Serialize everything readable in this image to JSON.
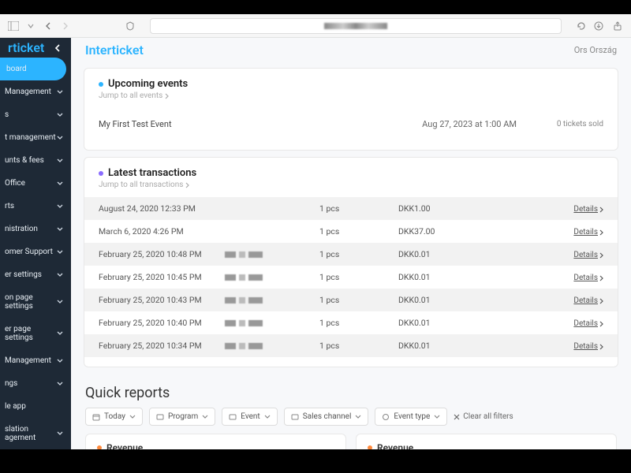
{
  "brand": "rticket",
  "main_title": "Interticket",
  "user": "Ors Ország",
  "sidebar": {
    "items": [
      {
        "label": "board",
        "active": true,
        "expandable": false
      },
      {
        "label": "Management",
        "expandable": true
      },
      {
        "label": "s",
        "expandable": true
      },
      {
        "label": "t management",
        "expandable": true
      },
      {
        "label": "unts & fees",
        "expandable": true
      },
      {
        "label": "Office",
        "expandable": true
      },
      {
        "label": "rts",
        "expandable": true
      },
      {
        "label": "nistration",
        "expandable": true
      },
      {
        "label": "omer Support",
        "expandable": true
      },
      {
        "label": "er settings",
        "expandable": true
      },
      {
        "label": "on page settings",
        "expandable": true
      },
      {
        "label": "er page settings",
        "expandable": true
      },
      {
        "label": "Management",
        "expandable": true
      },
      {
        "label": "ngs",
        "expandable": true
      },
      {
        "label": "le app",
        "expandable": false
      },
      {
        "label": "slation\nagement",
        "expandable": true
      }
    ]
  },
  "upcoming": {
    "title": "Upcoming events",
    "jump": "Jump to all events",
    "events": [
      {
        "name": "My First Test Event",
        "date": "Aug 27, 2023 at 1:00 AM",
        "tickets": "0 tickets sold"
      }
    ]
  },
  "transactions": {
    "title": "Latest transactions",
    "jump": "Jump to all transactions",
    "rows": [
      {
        "date": "August 24, 2020 12:33 PM",
        "qty": "1 pcs",
        "amount": "DKK1.00",
        "details": "Details",
        "blur": false
      },
      {
        "date": "March 6, 2020 4:26 PM",
        "qty": "1 pcs",
        "amount": "DKK37.00",
        "details": "Details",
        "blur": false
      },
      {
        "date": "February 25, 2020 10:48 PM",
        "qty": "1 pcs",
        "amount": "DKK0.01",
        "details": "Details",
        "blur": true
      },
      {
        "date": "February 25, 2020 10:45 PM",
        "qty": "1 pcs",
        "amount": "DKK0.01",
        "details": "Details",
        "blur": true
      },
      {
        "date": "February 25, 2020 10:43 PM",
        "qty": "1 pcs",
        "amount": "DKK0.01",
        "details": "Details",
        "blur": true
      },
      {
        "date": "February 25, 2020 10:40 PM",
        "qty": "1 pcs",
        "amount": "DKK0.01",
        "details": "Details",
        "blur": true
      },
      {
        "date": "February 25, 2020 10:34 PM",
        "qty": "1 pcs",
        "amount": "DKK0.01",
        "details": "Details",
        "blur": true
      }
    ]
  },
  "quick_reports": {
    "title": "Quick reports",
    "filters": [
      {
        "label": "Today",
        "icon": "calendar"
      },
      {
        "label": "Program",
        "icon": "tag"
      },
      {
        "label": "Event",
        "icon": "tag"
      },
      {
        "label": "Sales channel",
        "icon": "tag"
      },
      {
        "label": "Event type",
        "icon": "circle"
      }
    ],
    "clear": "Clear all filters",
    "revenue_label": "Revenue"
  }
}
